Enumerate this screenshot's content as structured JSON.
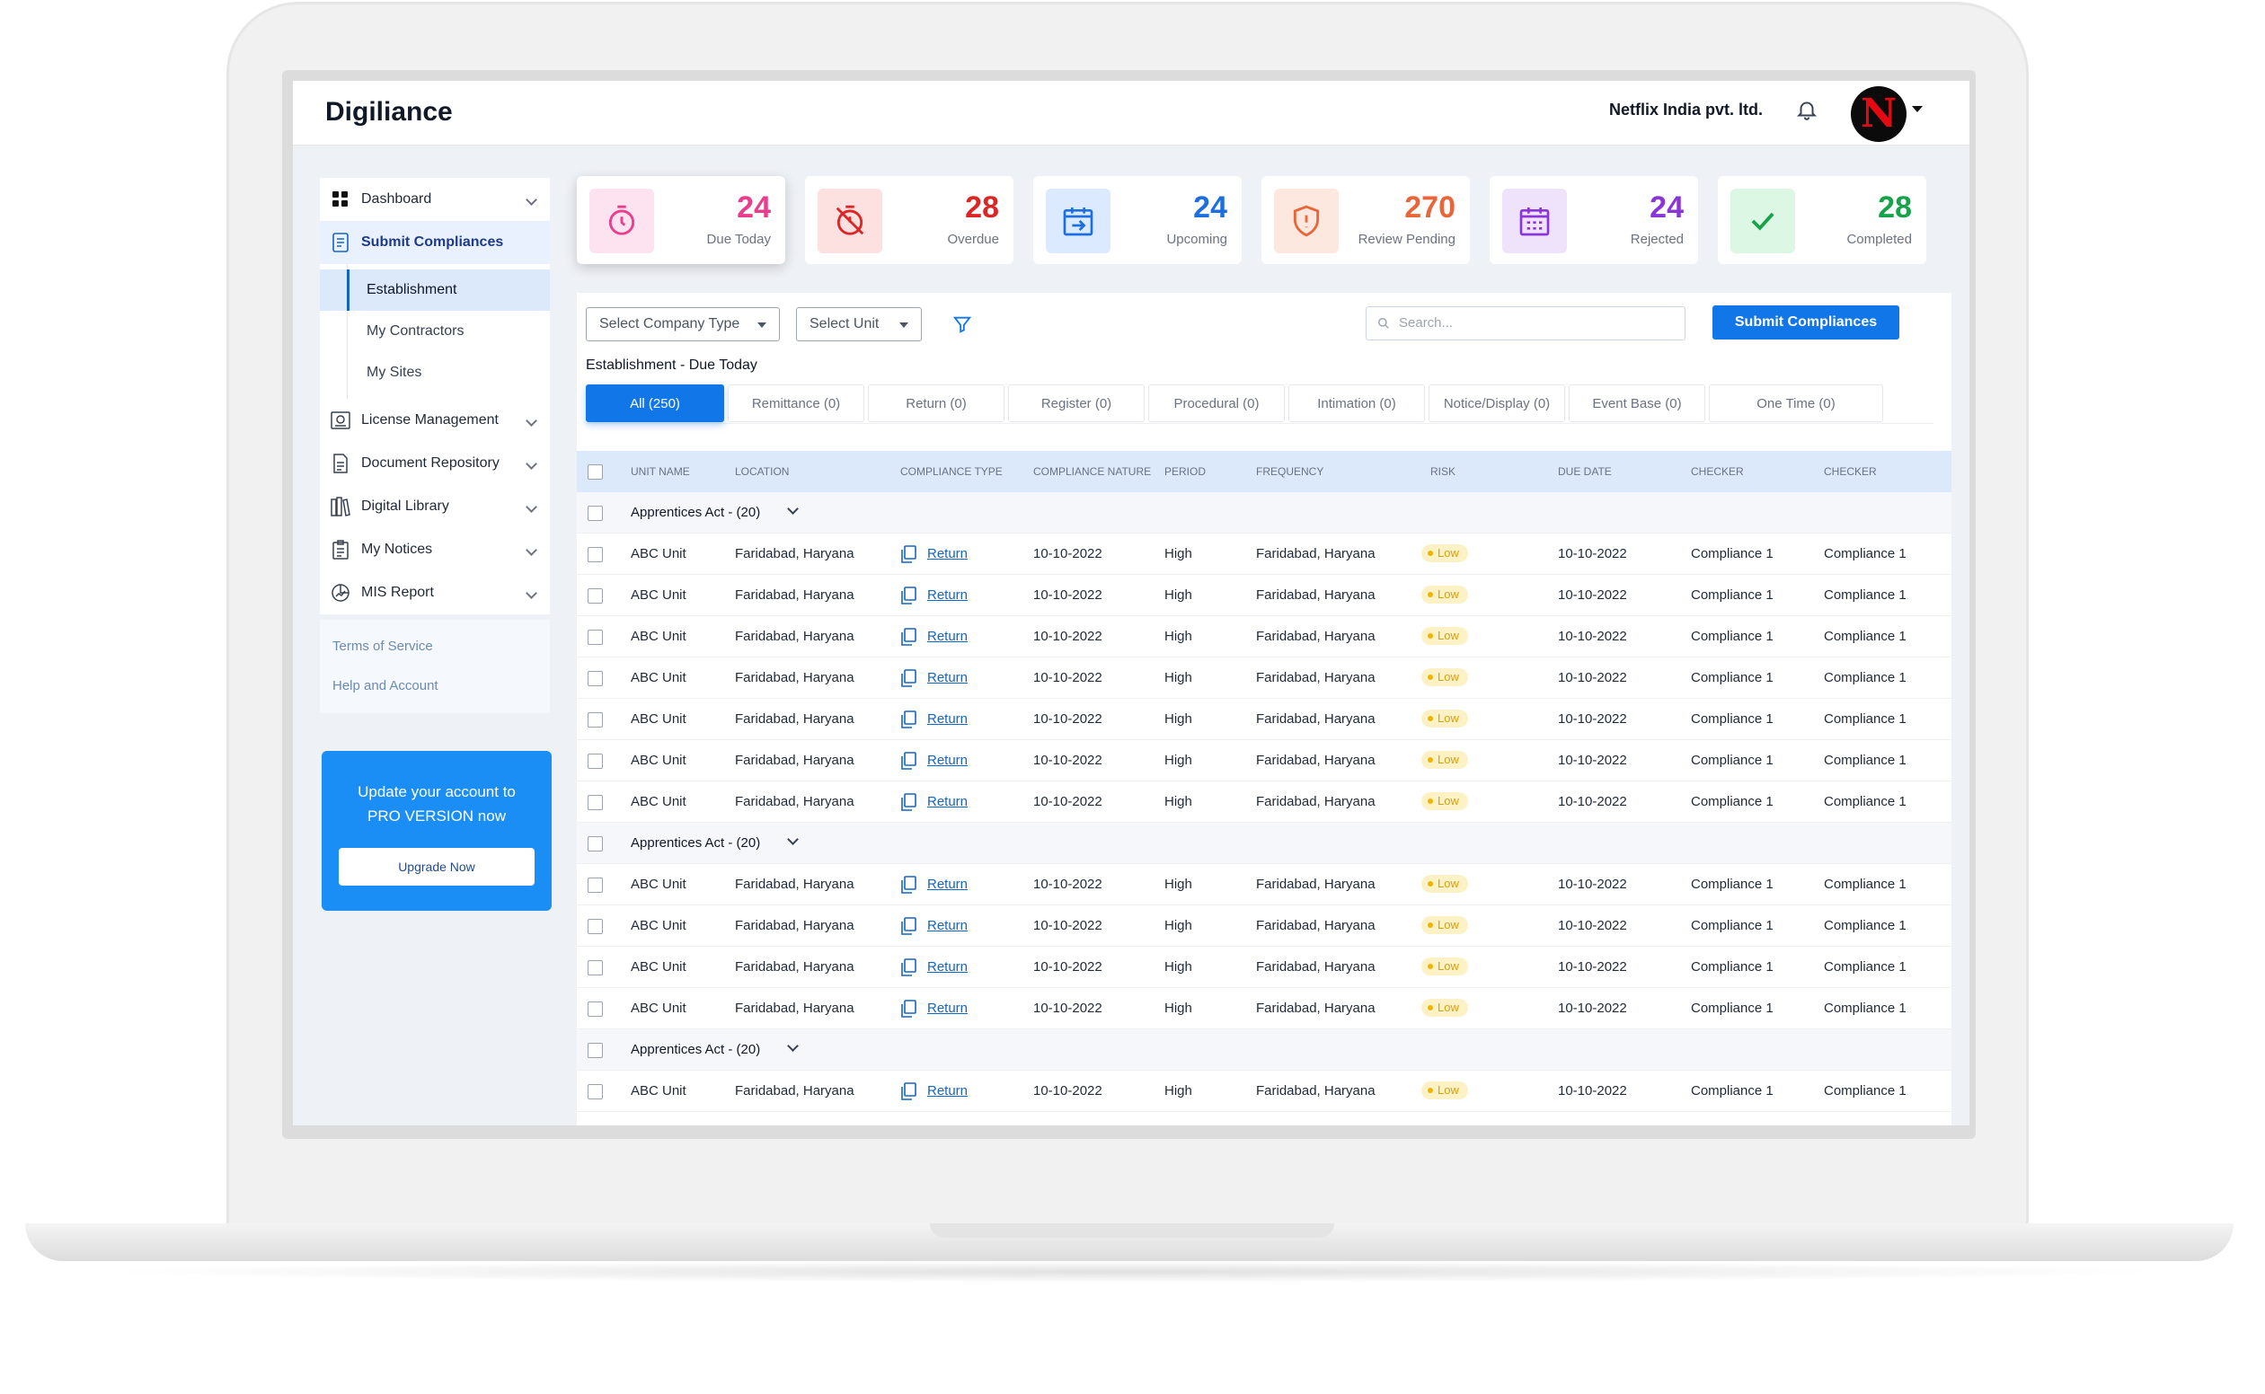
{
  "header": {
    "brand": "Digiliance",
    "company": "Netflix India pvt. ltd.",
    "avatar_letter": "N"
  },
  "sidebar": {
    "items": [
      {
        "label": "Dashboard",
        "icon": "grid-icon"
      },
      {
        "label": "Submit Compliances",
        "icon": "document-icon"
      },
      {
        "label": "License Management",
        "icon": "license-icon"
      },
      {
        "label": "Document Repository",
        "icon": "file-icon"
      },
      {
        "label": "Digital Library",
        "icon": "library-icon"
      },
      {
        "label": "My Notices",
        "icon": "notice-icon"
      },
      {
        "label": "MIS Report",
        "icon": "report-icon"
      }
    ],
    "sub_items": [
      "Establishment",
      "My Contractors",
      "My Sites"
    ],
    "footer_links": [
      "Terms of Service",
      "Help and Account"
    ],
    "promo": {
      "line1": "Update your account to",
      "line2": "PRO VERSION now",
      "button": "Upgrade Now"
    }
  },
  "stats": [
    {
      "value": "24",
      "label": "Due Today",
      "color": "#e83e8c",
      "bg": "#fde2ef",
      "icon": "timer-icon"
    },
    {
      "value": "28",
      "label": "Overdue",
      "color": "#dc2626",
      "bg": "#fde0e0",
      "icon": "timer-off-icon"
    },
    {
      "value": "24",
      "label": "Upcoming",
      "color": "#1d6fe0",
      "bg": "#dbeafe",
      "icon": "calendar-arrow-icon"
    },
    {
      "value": "270",
      "label": "Review Pending",
      "color": "#e8663a",
      "bg": "#fde8df",
      "icon": "shield-alert-icon"
    },
    {
      "value": "24",
      "label": "Rejected",
      "color": "#8b34d8",
      "bg": "#efe2fb",
      "icon": "calendar-grid-icon"
    },
    {
      "value": "28",
      "label": "Completed",
      "color": "#16a34a",
      "bg": "#dcf7e4",
      "icon": "check-icon"
    }
  ],
  "filters": {
    "company_type": "Select Company Type",
    "unit": "Select Unit",
    "search_placeholder": "Search...",
    "submit": "Submit Compliances"
  },
  "section_title": "Establishment - Due Today",
  "tabs": [
    "All (250)",
    "Remittance (0)",
    "Return (0)",
    "Register (0)",
    "Procedural (0)",
    "Intimation (0)",
    "Notice/Display (0)",
    "Event Base (0)",
    "One Time (0)"
  ],
  "columns": [
    "UNIT NAME",
    "LOCATION",
    "COMPLIANCE TYPE",
    "COMPLIANCE NATURE",
    "PERIOD",
    "FREQUENCY",
    "RISK",
    "DUE DATE",
    "CHECKER",
    "CHECKER"
  ],
  "groups": [
    {
      "label": "Apprentices Act - (20)",
      "rows": 7
    },
    {
      "label": "Apprentices Act - (20)",
      "rows": 4
    },
    {
      "label": "Apprentices Act - (20)",
      "rows": 1
    }
  ],
  "row_template": {
    "unit": "ABC Unit",
    "location": "Faridabad, Haryana",
    "type": "Return",
    "nature": "10-10-2022",
    "period": "High",
    "frequency": "Faridabad, Haryana",
    "risk": "Low",
    "due_date": "10-10-2022",
    "checker1": "Compliance 1",
    "checker2": "Compliance 1"
  }
}
